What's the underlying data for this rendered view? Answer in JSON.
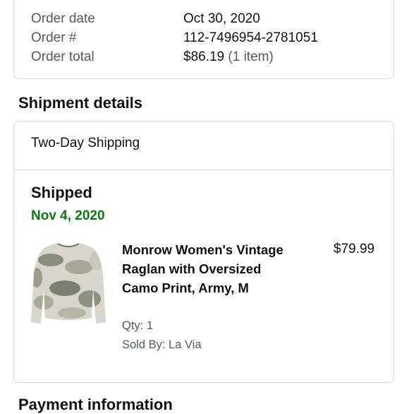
{
  "order_summary": {
    "order_date_label": "Order date",
    "order_date": "Oct 30, 2020",
    "order_number_label": "Order #",
    "order_number": "112-7496954-2781051",
    "order_total_label": "Order total",
    "order_total": "$86.19",
    "item_count": "(1 item)"
  },
  "shipment": {
    "section_title": "Shipment details",
    "method": "Two-Day Shipping",
    "status": "Shipped",
    "date": "Nov 4, 2020",
    "item": {
      "title": "Monrow Women's Vintage Raglan with Oversized Camo Print, Army, M",
      "price": "$79.99",
      "qty": "Qty: 1",
      "seller": "Sold By: La Via"
    }
  },
  "payment": {
    "section_title": "Payment information"
  },
  "colors": {
    "delivered_green": "#067d0e",
    "border": "#d5d9d9",
    "secondary_text": "#565959"
  }
}
